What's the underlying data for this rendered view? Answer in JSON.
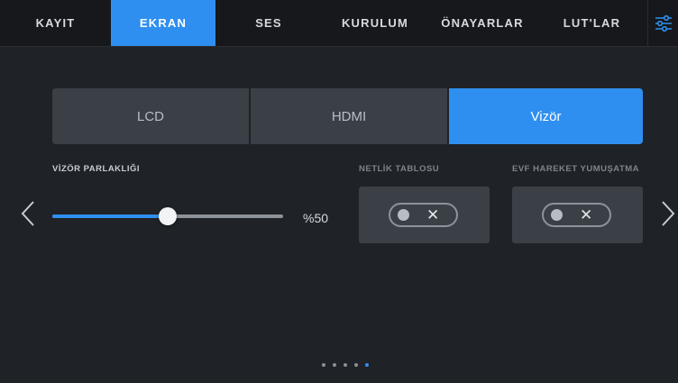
{
  "tabs": [
    {
      "label": "KAYIT",
      "active": false
    },
    {
      "label": "EKRAN",
      "active": true
    },
    {
      "label": "SES",
      "active": false
    },
    {
      "label": "KURULUM",
      "active": false
    },
    {
      "label": "ÖNAYARLAR",
      "active": false
    },
    {
      "label": "LUT'LAR",
      "active": false
    }
  ],
  "menu_icon": "sliders-icon",
  "outputs": [
    {
      "label": "LCD",
      "active": false
    },
    {
      "label": "HDMI",
      "active": false
    },
    {
      "label": "Vizör",
      "active": true
    }
  ],
  "brightness": {
    "label": "VİZÖR PARLAKLIĞI",
    "value_text": "%50",
    "fraction": 0.5
  },
  "focus_chart": {
    "label": "NETLİK TABLOSU",
    "enabled": false,
    "off_symbol": "✕"
  },
  "evf_smoothing": {
    "label": "EVF HAREKET YUMUŞATMA",
    "enabled": false,
    "off_symbol": "✕"
  },
  "nav": {
    "prev_icon": "chevron-left-icon",
    "next_icon": "chevron-right-icon"
  },
  "pagination": {
    "total": 5,
    "current": 5
  },
  "colors": {
    "accent": "#2f8ff0",
    "panel": "#3b4047",
    "background": "#1f2226"
  }
}
